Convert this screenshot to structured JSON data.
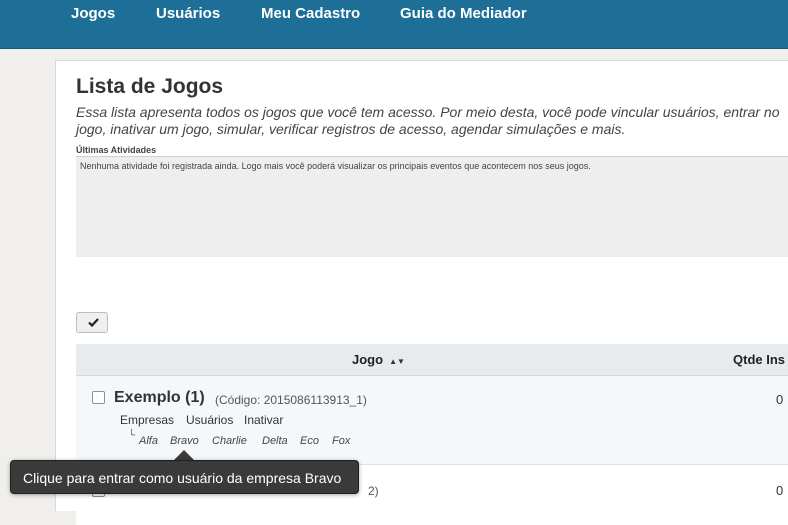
{
  "nav": {
    "items": [
      {
        "label": "Jogos"
      },
      {
        "label": "Usuários"
      },
      {
        "label": "Meu Cadastro"
      },
      {
        "label": "Guia do Mediador"
      }
    ]
  },
  "page": {
    "title": "Lista de Jogos",
    "description": "Essa lista apresenta todos os jogos que você tem acesso. Por meio desta, você pode vincular usuários, entrar no jogo, inativar um jogo, simular, verificar registros de acesso, agendar simulações e mais."
  },
  "activities": {
    "label": "Últimas Atividades",
    "text": "Nenhuma atividade foi registrada ainda. Logo mais você poderá visualizar os principais eventos que acontecem nos seus jogos."
  },
  "table": {
    "headers": {
      "jogo": "Jogo",
      "qtde": "Qtde Ins"
    },
    "rows": [
      {
        "name": "Exemplo (1)",
        "code": "(Código: 2015086113913_1)",
        "actions": [
          "Empresas",
          "Usuários",
          "Inativar"
        ],
        "companies": [
          "Alfa",
          "Bravo",
          "Charlie",
          "Delta",
          "Eco",
          "Fox"
        ],
        "qtde": "0"
      },
      {
        "code_tail": "2)",
        "qtde": "0"
      }
    ]
  },
  "tooltip": {
    "text": "Clique para entrar como usuário da empresa Bravo"
  },
  "colors": {
    "nav_bg": "#1d6f98",
    "tooltip_bg": "#3a3a3a",
    "header_bg": "#e8ebee"
  },
  "icons": {
    "bulk_select": "check-icon",
    "sort": "sort-icon",
    "tree": "tree-branch-icon"
  }
}
